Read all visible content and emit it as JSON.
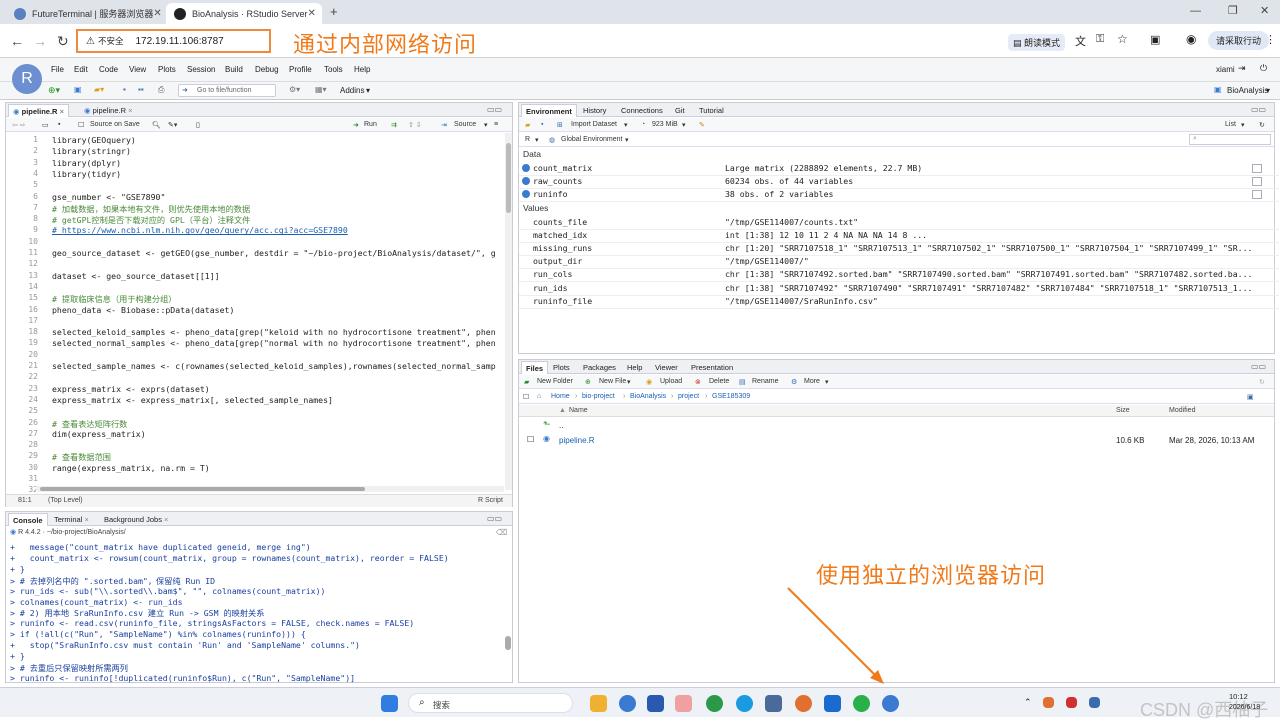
{
  "browser": {
    "tabs": [
      {
        "title": "FutureTerminal | 服务器浏览器",
        "active": false
      },
      {
        "title": "BioAnalysis · RStudio Server",
        "active": true
      }
    ],
    "new_tab": "+",
    "security_label": "不安全",
    "url": "172.19.11.106:8787",
    "reading_mode": "朗读模式",
    "cancel_action": "请采取行动"
  },
  "annotations": {
    "top": "通过内部网络访问",
    "bottom": "使用独立的浏览器访问"
  },
  "rstudio": {
    "menu": [
      "File",
      "Edit",
      "Code",
      "View",
      "Plots",
      "Session",
      "Build",
      "Debug",
      "Profile",
      "Tools",
      "Help"
    ],
    "user": "xiami",
    "project": "BioAnalysis",
    "goto_placeholder": "Go to file/function",
    "addins": "Addins",
    "logo": "R"
  },
  "editor": {
    "tabs": [
      "pipeline.R",
      "pipeline.R"
    ],
    "source_on_save": "Source on Save",
    "run": "Run",
    "source": "Source",
    "cursor": "81:1",
    "scope": "(Top Level)",
    "filetype": "R Script",
    "lines": [
      {
        "n": "1",
        "t": "library(GEOquery)",
        "k": "code"
      },
      {
        "n": "2",
        "t": "library(stringr)",
        "k": "code"
      },
      {
        "n": "3",
        "t": "library(dplyr)",
        "k": "code"
      },
      {
        "n": "4",
        "t": "library(tidyr)",
        "k": "code"
      },
      {
        "n": "5",
        "t": "",
        "k": "code"
      },
      {
        "n": "6",
        "t": "gse_number <- \"GSE7890\"",
        "k": "code"
      },
      {
        "n": "7",
        "t": "# 加载数据，如果本地有文件，则优先使用本地的数据",
        "k": "cmt"
      },
      {
        "n": "8",
        "t": "# getGPL控制是否下载对应的 GPL（平台）注释文件",
        "k": "cmt"
      },
      {
        "n": "9",
        "t": "# https://www.ncbi.nlm.nih.gov/geo/query/acc.cgi?acc=GSE7890",
        "k": "lnk"
      },
      {
        "n": "10",
        "t": "",
        "k": "code"
      },
      {
        "n": "11",
        "t": "geo_source_dataset <- getGEO(gse_number, destdir = \"~/bio-project/BioAnalysis/dataset/\", g",
        "k": "code"
      },
      {
        "n": "12",
        "t": "",
        "k": "code"
      },
      {
        "n": "13",
        "t": "dataset <- geo_source_dataset[[1]]",
        "k": "code"
      },
      {
        "n": "14",
        "t": "",
        "k": "code"
      },
      {
        "n": "15",
        "t": "# 提取临床信息（用于构建分组）",
        "k": "cmt"
      },
      {
        "n": "16",
        "t": "pheno_data <- Biobase::pData(dataset)",
        "k": "code"
      },
      {
        "n": "17",
        "t": "",
        "k": "code"
      },
      {
        "n": "18",
        "t": "selected_keloid_samples <- pheno_data[grep(\"keloid with no hydrocortisone treatment\", phen",
        "k": "code"
      },
      {
        "n": "19",
        "t": "selected_normal_samples <- pheno_data[grep(\"normal with no hydrocortisone treatment\", phen",
        "k": "code"
      },
      {
        "n": "20",
        "t": "",
        "k": "code"
      },
      {
        "n": "21",
        "t": "selected_sample_names <- c(rownames(selected_keloid_samples),rownames(selected_normal_samp",
        "k": "code"
      },
      {
        "n": "22",
        "t": "",
        "k": "code"
      },
      {
        "n": "23",
        "t": "express_matrix <- exprs(dataset)",
        "k": "code"
      },
      {
        "n": "24",
        "t": "express_matrix <- express_matrix[, selected_sample_names]",
        "k": "code"
      },
      {
        "n": "25",
        "t": "",
        "k": "code"
      },
      {
        "n": "26",
        "t": "# 查看表达矩阵行数",
        "k": "cmt"
      },
      {
        "n": "27",
        "t": "dim(express_matrix)",
        "k": "code"
      },
      {
        "n": "28",
        "t": "",
        "k": "code"
      },
      {
        "n": "29",
        "t": "# 查看数据范围",
        "k": "cmt"
      },
      {
        "n": "30",
        "t": "range(express_matrix, na.rm = T)",
        "k": "code"
      },
      {
        "n": "31",
        "t": "",
        "k": "code"
      },
      {
        "n": "32",
        "t": "",
        "k": "code"
      }
    ]
  },
  "console": {
    "tabs": [
      "Console",
      "Terminal",
      "Background Jobs"
    ],
    "rversion": "R 4.4.2 · ~/bio-project/BioAnalysis/",
    "lines": [
      "+   message(\"count_matrix have duplicated geneid, merge ing\")",
      "+   count_matrix <- rowsum(count_matrix, group = rownames(count_matrix), reorder = FALSE)",
      "+ }",
      "> # 去掉列名中的 \".sorted.bam\"，保留纯 Run ID",
      "> run_ids <- sub(\"\\\\.sorted\\\\.bam$\", \"\", colnames(count_matrix))",
      "> colnames(count_matrix) <- run_ids",
      "> # 2) 用本地 SraRunInfo.csv 建立 Run -> GSM 的映射关系",
      "> runinfo <- read.csv(runinfo_file, stringsAsFactors = FALSE, check.names = FALSE)",
      "> if (!all(c(\"Run\", \"SampleName\") %in% colnames(runinfo))) {",
      "+   stop(\"SraRunInfo.csv must contain 'Run' and 'SampleName' columns.\")",
      "+ }",
      "> # 去重后只保留映射所需两列",
      "> runinfo <- runinfo[!duplicated(runinfo$Run), c(\"Run\", \"SampleName\")]"
    ]
  },
  "environment": {
    "tabs": [
      "Environment",
      "History",
      "Connections",
      "Git",
      "Tutorial"
    ],
    "import": "Import Dataset",
    "memory": "923 MiB",
    "list": "List",
    "lang": "R",
    "scope": "Global Environment",
    "data_header": "Data",
    "values_header": "Values",
    "data": [
      {
        "name": "count_matrix",
        "value": "Large matrix (2288892 elements, 22.7 MB)"
      },
      {
        "name": "raw_counts",
        "value": "60234 obs. of 44 variables"
      },
      {
        "name": "runinfo",
        "value": "38 obs. of 2 variables"
      }
    ],
    "values": [
      {
        "name": "counts_file",
        "value": "\"/tmp/GSE114007/counts.txt\""
      },
      {
        "name": "matched_idx",
        "value": "int [1:38] 12 10 11 2 4 NA NA NA 14 8 ..."
      },
      {
        "name": "missing_runs",
        "value": "chr [1:20] \"SRR7107518_1\" \"SRR7107513_1\" \"SRR7107502_1\" \"SRR7107500_1\" \"SRR7107504_1\" \"SRR7107499_1\" \"SR..."
      },
      {
        "name": "output_dir",
        "value": "\"/tmp/GSE114007/\""
      },
      {
        "name": "run_cols",
        "value": "chr [1:38] \"SRR7107492.sorted.bam\" \"SRR7107490.sorted.bam\" \"SRR7107491.sorted.bam\" \"SRR7107482.sorted.ba..."
      },
      {
        "name": "run_ids",
        "value": "chr [1:38] \"SRR7107492\" \"SRR7107490\" \"SRR7107491\" \"SRR7107482\" \"SRR7107484\" \"SRR7107518_1\" \"SRR7107513_1..."
      },
      {
        "name": "runinfo_file",
        "value": "\"/tmp/GSE114007/SraRunInfo.csv\""
      }
    ]
  },
  "files": {
    "tabs": [
      "Files",
      "Plots",
      "Packages",
      "Help",
      "Viewer",
      "Presentation"
    ],
    "toolbar": [
      "New Folder",
      "New File",
      "Upload",
      "Delete",
      "Rename",
      "More"
    ],
    "breadcrumb": [
      "Home",
      "bio-project",
      "BioAnalysis",
      "project",
      "GSE185309"
    ],
    "cols": [
      "Name",
      "Size",
      "Modified"
    ],
    "up": "..",
    "rows": [
      {
        "name": "pipeline.R",
        "size": "10.6 KB",
        "modified": "Mar 28, 2026, 10:13 AM"
      }
    ]
  },
  "taskbar": {
    "search": "搜索",
    "time": "10:12",
    "date": "2026/6/18",
    "watermark": "CSDN @西柚子"
  }
}
